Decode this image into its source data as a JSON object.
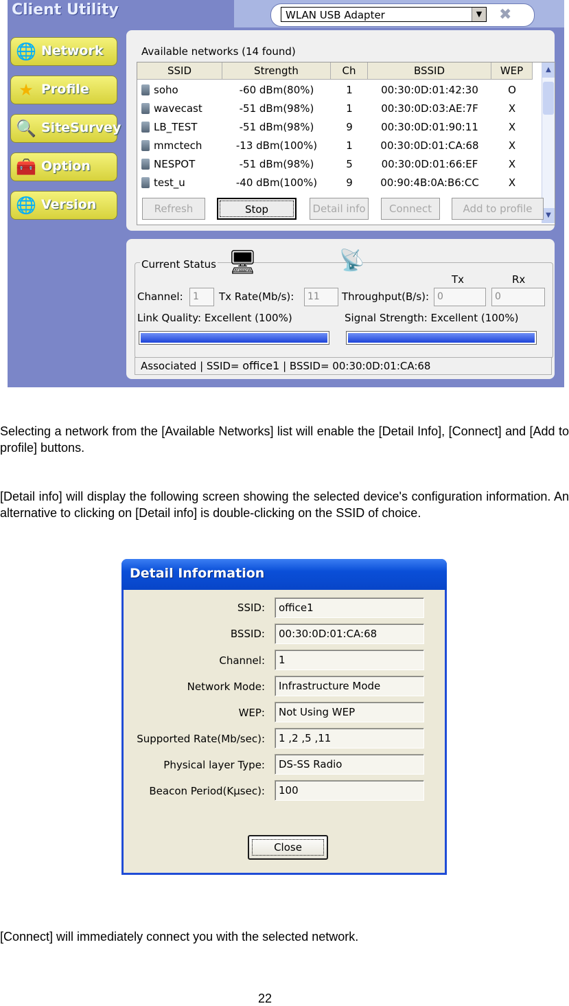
{
  "client_utility": {
    "title": "Client Utility",
    "adapter": "WLAN USB Adapter",
    "nav": [
      {
        "label": "Network",
        "icon": "globe-icon"
      },
      {
        "label": "Profile",
        "icon": "star-icon"
      },
      {
        "label": "SiteSurvey",
        "icon": "magnifier-icon"
      },
      {
        "label": "Option",
        "icon": "toolbox-icon"
      },
      {
        "label": "Version",
        "icon": "globe-icon"
      }
    ],
    "available_title": "Available networks  (14 found)",
    "columns": [
      "SSID",
      "Strength",
      "Ch",
      "BSSID",
      "WEP"
    ],
    "rows": [
      {
        "ssid": "soho",
        "strength": "-60 dBm(80%)",
        "ch": "1",
        "bssid": "00:30:0D:01:42:30",
        "wep": "O"
      },
      {
        "ssid": "wavecast",
        "strength": "-51 dBm(98%)",
        "ch": "1",
        "bssid": "00:30:0D:03:AE:7F",
        "wep": "X"
      },
      {
        "ssid": "LB_TEST",
        "strength": "-51 dBm(98%)",
        "ch": "9",
        "bssid": "00:30:0D:01:90:11",
        "wep": "X"
      },
      {
        "ssid": "mmctech",
        "strength": "-13 dBm(100%)",
        "ch": "1",
        "bssid": "00:30:0D:01:CA:68",
        "wep": "X"
      },
      {
        "ssid": "NESPOT",
        "strength": "-51 dBm(98%)",
        "ch": "5",
        "bssid": "00:30:0D:01:66:EF",
        "wep": "X"
      },
      {
        "ssid": "test_u",
        "strength": "-40 dBm(100%)",
        "ch": "9",
        "bssid": "00:90:4B:0A:B6:CC",
        "wep": "X"
      }
    ],
    "buttons": {
      "refresh": "Refresh",
      "stop": "Stop",
      "detail": "Detail info",
      "connect": "Connect",
      "add": "Add to profile"
    },
    "status": {
      "title": "Current Status",
      "channel_label": "Channel:",
      "channel": "1",
      "txrate_label": "Tx Rate(Mb/s):",
      "txrate": "11",
      "throughput_label": "Throughput(B/s):",
      "tx_head": "Tx",
      "rx_head": "Rx",
      "tx": "0",
      "rx": "0",
      "link_quality": "Link Quality:  Excellent (100%)",
      "signal_strength": "Signal Strength:  Excellent (100%)",
      "link_quality_level": 1.0,
      "signal_strength_level": 1.0,
      "assoc_prefix": "Associated | SSID= ",
      "assoc_ssid": "office1",
      "assoc_suffix": "  | BSSID= 00:30:0D:01:CA:68"
    }
  },
  "text": {
    "p1": "Selecting a network from the [Available Networks] list will enable the [Detail Info], [Connect] and [Add to profile] buttons.",
    "p2": "[Detail info] will display the following screen showing the selected device's configuration information. An alternative to clicking on [Detail info] is double-clicking on the SSID of choice.",
    "p3": "[Connect] will immediately connect you with the selected network.",
    "page_number": "22"
  },
  "detail": {
    "title": "Detail Information",
    "fields": [
      {
        "label": "SSID:",
        "value": "office1"
      },
      {
        "label": "BSSID:",
        "value": "00:30:0D:01:CA:68"
      },
      {
        "label": "Channel:",
        "value": "1"
      },
      {
        "label": "Network Mode:",
        "value": "Infrastructure Mode"
      },
      {
        "label": "WEP:",
        "value": "Not Using WEP"
      },
      {
        "label": "Supported Rate(Mb/sec):",
        "value": "1 ,2 ,5 ,11"
      },
      {
        "label": "Physical layer Type:",
        "value": "DS-SS Radio"
      },
      {
        "label": "Beacon Period(Kµsec):",
        "value": "100"
      }
    ],
    "close": "Close"
  }
}
